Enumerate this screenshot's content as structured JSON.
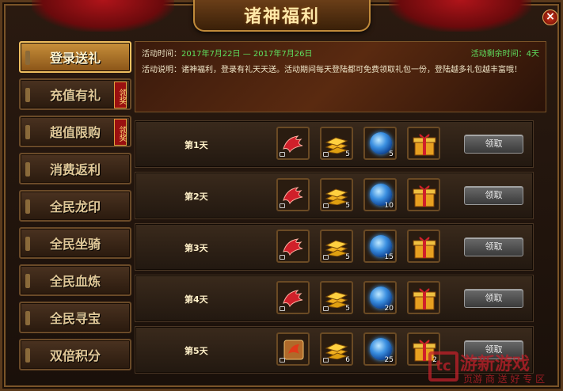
{
  "window": {
    "title": "诸神福利",
    "close_label": "×"
  },
  "sidebar": {
    "items": [
      {
        "label": "登录送礼",
        "active": true,
        "badge": ""
      },
      {
        "label": "充值有礼",
        "active": false,
        "badge": "领奖"
      },
      {
        "label": "超值限购",
        "active": false,
        "badge": "领奖"
      },
      {
        "label": "消费返利",
        "active": false,
        "badge": ""
      },
      {
        "label": "全民龙印",
        "active": false,
        "badge": ""
      },
      {
        "label": "全民坐骑",
        "active": false,
        "badge": ""
      },
      {
        "label": "全民血炼",
        "active": false,
        "badge": ""
      },
      {
        "label": "全民寻宝",
        "active": false,
        "badge": ""
      },
      {
        "label": "双倍积分",
        "active": false,
        "badge": ""
      }
    ]
  },
  "info": {
    "time_label": "活动时间：",
    "time_value": "2017年7月22日 — 2017年7月26日",
    "remain_label": "活动剩余时间：",
    "remain_value": "4天",
    "desc": "活动说明：诸神福利，登录有礼天天送。活动期间每天登陆都可免费领取礼包一份，登陆越多礼包越丰富哦！"
  },
  "rows": [
    {
      "day": "第1天",
      "gold": "5",
      "orb": "5",
      "claim": "领取"
    },
    {
      "day": "第2天",
      "gold": "5",
      "orb": "10",
      "claim": "领取"
    },
    {
      "day": "第3天",
      "gold": "5",
      "orb": "15",
      "claim": "领取"
    },
    {
      "day": "第4天",
      "gold": "5",
      "orb": "20",
      "claim": "领取"
    },
    {
      "day": "第5天",
      "gold": "6",
      "orb": "25",
      "gift": "2",
      "claim": "领取"
    }
  ],
  "icons": {
    "wing": "red-wing-icon",
    "gold": "gold-bar-icon",
    "orb": "blue-orb-icon",
    "gift": "gift-box-icon",
    "scroll": "scroll-icon"
  },
  "watermark": {
    "big": "游新游戏",
    "small": "页游 商 送 好 专 区"
  }
}
